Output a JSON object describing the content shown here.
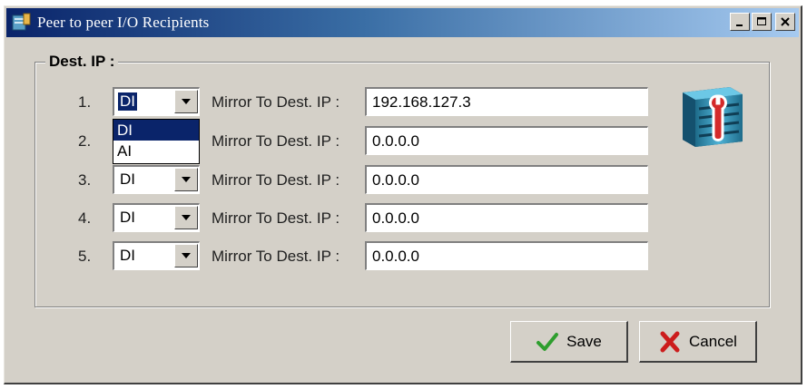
{
  "window": {
    "title": "Peer to peer I/O Recipients",
    "minimize_glyph": "_",
    "maximize_glyph": "□",
    "close_glyph": "×"
  },
  "group": {
    "label": "Dest. IP :"
  },
  "rows": [
    {
      "number": "1.",
      "type": "DI",
      "label": "Mirror To Dest. IP :",
      "ip": "192.168.127.3"
    },
    {
      "number": "2.",
      "type": "DI",
      "label": "Mirror To Dest. IP :",
      "ip": "0.0.0.0"
    },
    {
      "number": "3.",
      "type": "DI",
      "label": "Mirror To Dest. IP :",
      "ip": "0.0.0.0"
    },
    {
      "number": "4.",
      "type": "DI",
      "label": "Mirror To Dest. IP :",
      "ip": "0.0.0.0"
    },
    {
      "number": "5.",
      "type": "DI",
      "label": "Mirror To Dest. IP :",
      "ip": "0.0.0.0"
    }
  ],
  "dropdown": {
    "options": [
      "DI",
      "AI"
    ],
    "highlighted": "DI"
  },
  "buttons": {
    "save_label": "Save",
    "cancel_label": "Cancel"
  },
  "icons": {
    "window_icon": "app-icon",
    "tools_icon": "server-wrench-icon",
    "save_icon": "checkmark-icon",
    "cancel_icon": "x-mark-icon"
  },
  "colors": {
    "titlebar_start": "#0a246a",
    "titlebar_end": "#a6caf0",
    "face": "#d4d0c8",
    "selection": "#0a246a",
    "check_green": "#2e9e2e",
    "cancel_red": "#cc1c1c"
  }
}
